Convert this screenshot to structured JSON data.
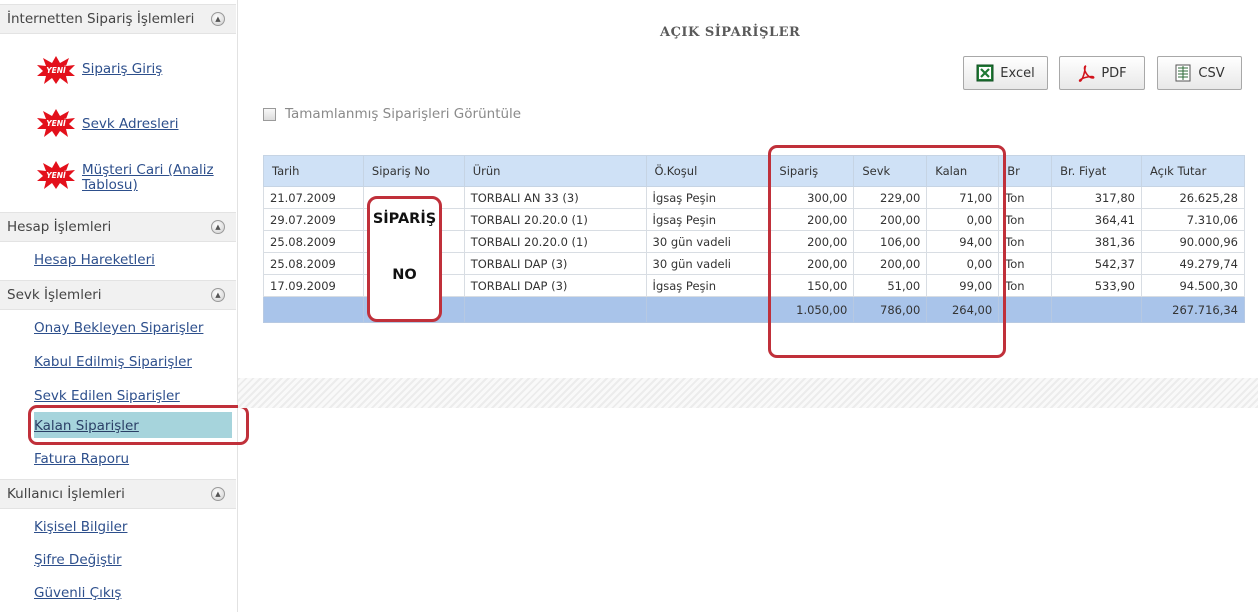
{
  "sidebar": {
    "sections": [
      {
        "title": "İnternetten Sipariş İşlemleri",
        "items": [
          "Sipariş Giriş",
          "Sevk Adresleri",
          "Müşteri Cari (Analiz Tablosu)"
        ]
      },
      {
        "title": "Hesap İşlemleri",
        "items": [
          "Hesap Hareketleri"
        ]
      },
      {
        "title": "Sevk İşlemleri",
        "items": [
          "Onay Bekleyen Siparişler",
          "Kabul Edilmiş Siparişler",
          "Sevk Edilen Siparişler",
          "Kalan Siparişler",
          "Fatura Raporu"
        ]
      },
      {
        "title": "Kullanıcı İşlemleri",
        "items": [
          "Kişisel Bilgiler",
          "Şifre Değiştir",
          "Güvenli Çıkış"
        ]
      }
    ],
    "new_badge": "YENİ",
    "active_item": "Kalan Siparişler"
  },
  "main": {
    "title": "AÇIK SİPARİŞLER",
    "export_buttons": {
      "excel": "Excel",
      "pdf": "PDF",
      "csv": "CSV"
    },
    "show_completed_label": "Tamamlanmış Siparişleri Görüntüle",
    "callout": {
      "line1": "SİPARİŞ",
      "line2": "NO"
    }
  },
  "table": {
    "columns": [
      "Tarih",
      "Sipariş No",
      "Ürün",
      "Ö.Koşul",
      "Sipariş",
      "Sevk",
      "Kalan",
      "Br",
      "Br. Fiyat",
      "Açık Tutar"
    ],
    "rows": [
      {
        "tarih": "21.07.2009",
        "sipno": "",
        "urun": "TORBALI AN 33 (3)",
        "kosul": "İgsaş Peşin",
        "siparis": "300,00",
        "sevk": "229,00",
        "kalan": "71,00",
        "br": "Ton",
        "fiyat": "317,80",
        "acik": "26.625,28"
      },
      {
        "tarih": "29.07.2009",
        "sipno": "",
        "urun": "TORBALI 20.20.0 (1)",
        "kosul": "İgsaş Peşin",
        "siparis": "200,00",
        "sevk": "200,00",
        "kalan": "0,00",
        "br": "Ton",
        "fiyat": "364,41",
        "acik": "7.310,06"
      },
      {
        "tarih": "25.08.2009",
        "sipno": "",
        "urun": "TORBALI 20.20.0 (1)",
        "kosul": "30 gün vadeli",
        "siparis": "200,00",
        "sevk": "106,00",
        "kalan": "94,00",
        "br": "Ton",
        "fiyat": "381,36",
        "acik": "90.000,96"
      },
      {
        "tarih": "25.08.2009",
        "sipno": "",
        "urun": "TORBALI DAP (3)",
        "kosul": "30 gün vadeli",
        "siparis": "200,00",
        "sevk": "200,00",
        "kalan": "0,00",
        "br": "Ton",
        "fiyat": "542,37",
        "acik": "49.279,74"
      },
      {
        "tarih": "17.09.2009",
        "sipno": "",
        "urun": "TORBALI DAP (3)",
        "kosul": "İgsaş Peşin",
        "siparis": "150,00",
        "sevk": "51,00",
        "kalan": "99,00",
        "br": "Ton",
        "fiyat": "533,90",
        "acik": "94.500,30"
      }
    ],
    "totals": {
      "siparis": "1.050,00",
      "sevk": "786,00",
      "kalan": "264,00",
      "acik": "267.716,34"
    }
  },
  "colors": {
    "highlight": "#c0303a",
    "header_bg": "#cfe1f6",
    "total_bg": "#a9c4ea",
    "link": "#2d4f8c",
    "active_item_bg": "#a6d4dc"
  }
}
